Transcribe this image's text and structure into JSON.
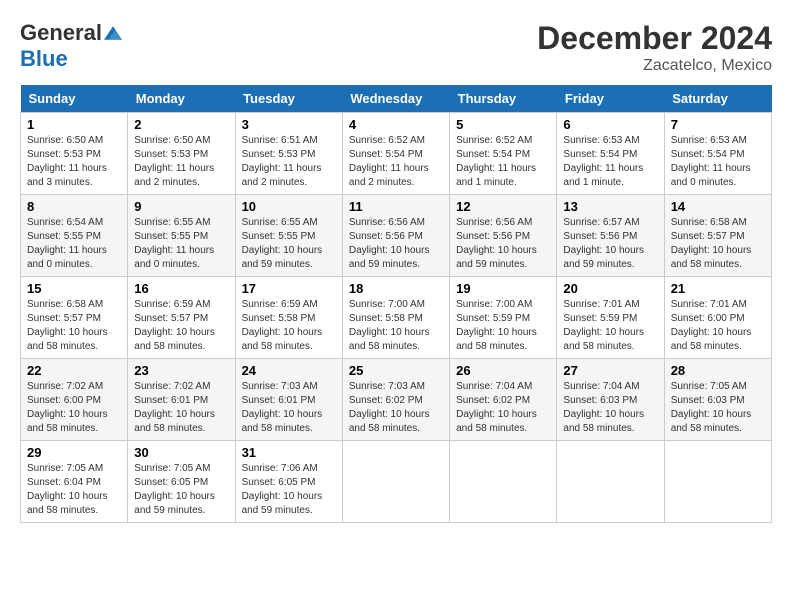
{
  "header": {
    "logo_general": "General",
    "logo_blue": "Blue",
    "month": "December 2024",
    "location": "Zacatelco, Mexico"
  },
  "weekdays": [
    "Sunday",
    "Monday",
    "Tuesday",
    "Wednesday",
    "Thursday",
    "Friday",
    "Saturday"
  ],
  "weeks": [
    [
      {
        "day": "1",
        "sunrise": "6:50 AM",
        "sunset": "5:53 PM",
        "daylight": "11 hours and 3 minutes."
      },
      {
        "day": "2",
        "sunrise": "6:50 AM",
        "sunset": "5:53 PM",
        "daylight": "11 hours and 2 minutes."
      },
      {
        "day": "3",
        "sunrise": "6:51 AM",
        "sunset": "5:53 PM",
        "daylight": "11 hours and 2 minutes."
      },
      {
        "day": "4",
        "sunrise": "6:52 AM",
        "sunset": "5:54 PM",
        "daylight": "11 hours and 2 minutes."
      },
      {
        "day": "5",
        "sunrise": "6:52 AM",
        "sunset": "5:54 PM",
        "daylight": "11 hours and 1 minute."
      },
      {
        "day": "6",
        "sunrise": "6:53 AM",
        "sunset": "5:54 PM",
        "daylight": "11 hours and 1 minute."
      },
      {
        "day": "7",
        "sunrise": "6:53 AM",
        "sunset": "5:54 PM",
        "daylight": "11 hours and 0 minutes."
      }
    ],
    [
      {
        "day": "8",
        "sunrise": "6:54 AM",
        "sunset": "5:55 PM",
        "daylight": "11 hours and 0 minutes."
      },
      {
        "day": "9",
        "sunrise": "6:55 AM",
        "sunset": "5:55 PM",
        "daylight": "11 hours and 0 minutes."
      },
      {
        "day": "10",
        "sunrise": "6:55 AM",
        "sunset": "5:55 PM",
        "daylight": "10 hours and 59 minutes."
      },
      {
        "day": "11",
        "sunrise": "6:56 AM",
        "sunset": "5:56 PM",
        "daylight": "10 hours and 59 minutes."
      },
      {
        "day": "12",
        "sunrise": "6:56 AM",
        "sunset": "5:56 PM",
        "daylight": "10 hours and 59 minutes."
      },
      {
        "day": "13",
        "sunrise": "6:57 AM",
        "sunset": "5:56 PM",
        "daylight": "10 hours and 59 minutes."
      },
      {
        "day": "14",
        "sunrise": "6:58 AM",
        "sunset": "5:57 PM",
        "daylight": "10 hours and 58 minutes."
      }
    ],
    [
      {
        "day": "15",
        "sunrise": "6:58 AM",
        "sunset": "5:57 PM",
        "daylight": "10 hours and 58 minutes."
      },
      {
        "day": "16",
        "sunrise": "6:59 AM",
        "sunset": "5:57 PM",
        "daylight": "10 hours and 58 minutes."
      },
      {
        "day": "17",
        "sunrise": "6:59 AM",
        "sunset": "5:58 PM",
        "daylight": "10 hours and 58 minutes."
      },
      {
        "day": "18",
        "sunrise": "7:00 AM",
        "sunset": "5:58 PM",
        "daylight": "10 hours and 58 minutes."
      },
      {
        "day": "19",
        "sunrise": "7:00 AM",
        "sunset": "5:59 PM",
        "daylight": "10 hours and 58 minutes."
      },
      {
        "day": "20",
        "sunrise": "7:01 AM",
        "sunset": "5:59 PM",
        "daylight": "10 hours and 58 minutes."
      },
      {
        "day": "21",
        "sunrise": "7:01 AM",
        "sunset": "6:00 PM",
        "daylight": "10 hours and 58 minutes."
      }
    ],
    [
      {
        "day": "22",
        "sunrise": "7:02 AM",
        "sunset": "6:00 PM",
        "daylight": "10 hours and 58 minutes."
      },
      {
        "day": "23",
        "sunrise": "7:02 AM",
        "sunset": "6:01 PM",
        "daylight": "10 hours and 58 minutes."
      },
      {
        "day": "24",
        "sunrise": "7:03 AM",
        "sunset": "6:01 PM",
        "daylight": "10 hours and 58 minutes."
      },
      {
        "day": "25",
        "sunrise": "7:03 AM",
        "sunset": "6:02 PM",
        "daylight": "10 hours and 58 minutes."
      },
      {
        "day": "26",
        "sunrise": "7:04 AM",
        "sunset": "6:02 PM",
        "daylight": "10 hours and 58 minutes."
      },
      {
        "day": "27",
        "sunrise": "7:04 AM",
        "sunset": "6:03 PM",
        "daylight": "10 hours and 58 minutes."
      },
      {
        "day": "28",
        "sunrise": "7:05 AM",
        "sunset": "6:03 PM",
        "daylight": "10 hours and 58 minutes."
      }
    ],
    [
      {
        "day": "29",
        "sunrise": "7:05 AM",
        "sunset": "6:04 PM",
        "daylight": "10 hours and 58 minutes."
      },
      {
        "day": "30",
        "sunrise": "7:05 AM",
        "sunset": "6:05 PM",
        "daylight": "10 hours and 59 minutes."
      },
      {
        "day": "31",
        "sunrise": "7:06 AM",
        "sunset": "6:05 PM",
        "daylight": "10 hours and 59 minutes."
      },
      null,
      null,
      null,
      null
    ]
  ],
  "labels": {
    "sunrise_prefix": "Sunrise: ",
    "sunset_prefix": "Sunset: ",
    "daylight_prefix": "Daylight: "
  }
}
